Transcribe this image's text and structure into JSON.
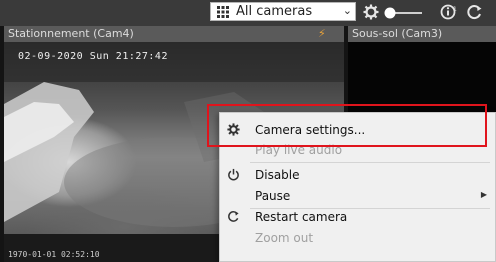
{
  "toolbar": {
    "camera_select": "All cameras",
    "icons": [
      "grid-icon",
      "chevron-down-icon",
      "gear-icon",
      "toggle-icon",
      "info-icon",
      "refresh-icon"
    ]
  },
  "panes": {
    "left_title": "Stationnement (Cam4)",
    "right_title": "Sous-sol (Cam3)",
    "left_timestamp": "02-09-2020 Sun 21:27:42",
    "bottom_timestamp": "1970-01-01 02:52:10"
  },
  "context_menu": {
    "items": [
      {
        "label": "Camera settings...",
        "icon": "gear-icon",
        "enabled": true
      },
      {
        "label": "Play live audio",
        "icon": "",
        "enabled": false
      },
      {
        "label": "Disable",
        "icon": "power-icon",
        "enabled": true
      },
      {
        "label": "Pause",
        "icon": "",
        "enabled": true,
        "submenu": true
      },
      {
        "label": "Restart camera",
        "icon": "restart-icon",
        "enabled": true
      },
      {
        "label": "Zoom out",
        "icon": "",
        "enabled": false
      }
    ]
  },
  "colors": {
    "highlight": "#e0141c",
    "alert_icon": "#e8a23a"
  }
}
